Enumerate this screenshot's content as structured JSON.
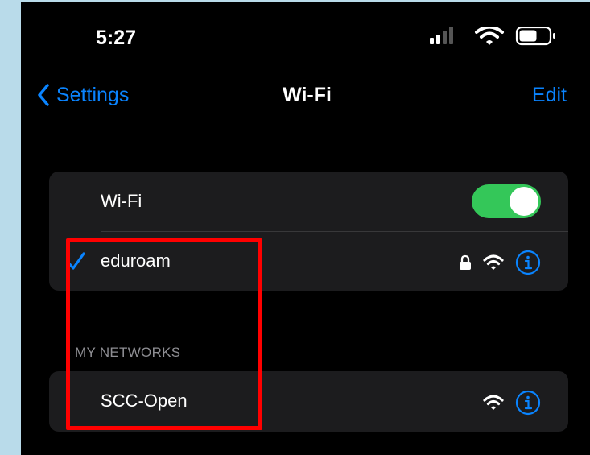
{
  "status_bar": {
    "time": "5:27"
  },
  "nav": {
    "back_label": "Settings",
    "title": "Wi-Fi",
    "edit_label": "Edit"
  },
  "wifi_toggle": {
    "label": "Wi-Fi",
    "on": true
  },
  "connected_network": {
    "name": "eduroam",
    "connected": true,
    "secured": true
  },
  "my_networks": {
    "header": "MY NETWORKS",
    "items": [
      {
        "name": "SCC-Open",
        "secured": false
      }
    ]
  },
  "colors": {
    "accent": "#0a84ff",
    "toggle_on": "#34c759",
    "group_background": "#1c1c1e",
    "highlight": "#ff0000"
  },
  "icons": [
    "chevron-left-icon",
    "signal-icon",
    "wifi-icon",
    "battery-icon",
    "checkmark-icon",
    "lock-icon",
    "info-icon"
  ]
}
